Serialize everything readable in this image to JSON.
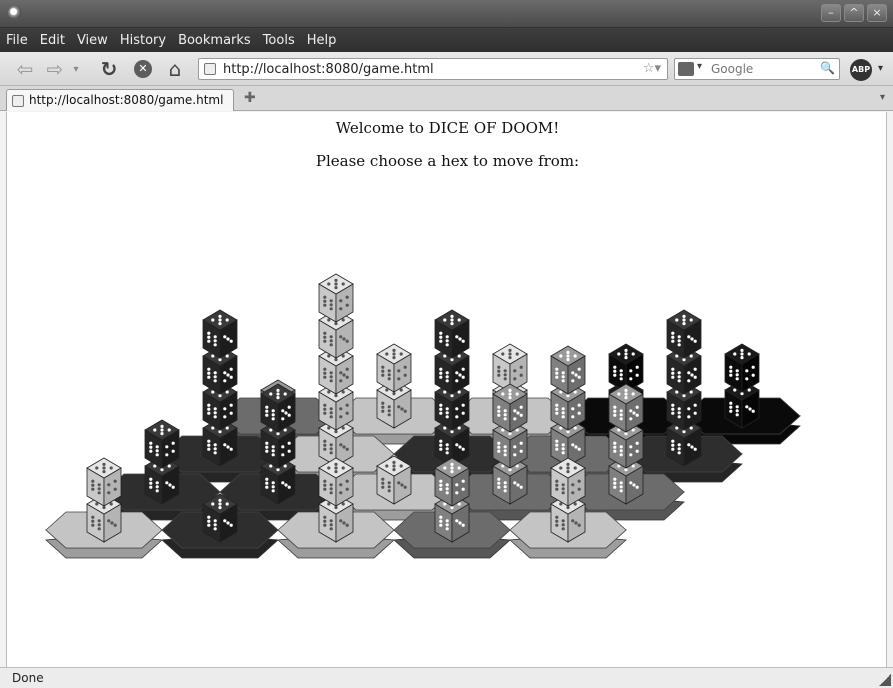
{
  "window": {
    "min_glyph": "–",
    "max_glyph": "^",
    "close_glyph": "×"
  },
  "menu": [
    "File",
    "Edit",
    "View",
    "History",
    "Bookmarks",
    "Tools",
    "Help"
  ],
  "toolbar": {
    "back_glyph": "⇦",
    "forward_glyph": "⇨",
    "history_dropdown_glyph": "▾",
    "reload_glyph": "↻",
    "stop_glyph": "✕",
    "home_glyph": "⌂",
    "url": "http://localhost:8080/game.html",
    "bookmark_star": "☆▾",
    "search_placeholder": "Google",
    "search_engine_dropdown": "▾",
    "search_glyph": "🔍",
    "adblock_label": "ABP",
    "adblock_dropdown": "▾"
  },
  "tabs": [
    {
      "label": "http://localhost:8080/game.html",
      "active": true
    }
  ],
  "tab_controls": {
    "new_tab_glyph": "✚",
    "list_all_glyph": "▾"
  },
  "page": {
    "welcome": "Welcome to DICE OF DOOM!",
    "prompt": "Please choose a hex to move from:"
  },
  "status": {
    "text": "Done"
  },
  "colors": {
    "player_fills": [
      "#c4c4c4",
      "#2e2e2e",
      "#6c6c6c",
      "#0a0a0a"
    ],
    "die_faces": [
      {
        "top": "#e6e6e6",
        "left": "#c8c8c8",
        "right": "#b4b4b4",
        "pip": "#555555"
      },
      {
        "top": "#3a3a3a",
        "left": "#262626",
        "right": "#1c1c1c",
        "pip": "#ffffff"
      },
      {
        "top": "#9a9a9a",
        "left": "#808080",
        "right": "#6e6e6e",
        "pip": "#ffffff"
      },
      {
        "top": "#1a1a1a",
        "left": "#0c0c0c",
        "right": "#050505",
        "pip": "#ffffff"
      }
    ]
  },
  "board": {
    "rows": 4,
    "cols": 5,
    "cells": [
      {
        "player": 2,
        "dice": 1
      },
      {
        "player": 0,
        "dice": 2
      },
      {
        "player": 0,
        "dice": 2
      },
      {
        "player": 3,
        "dice": 2
      },
      {
        "player": 3,
        "dice": 2
      },
      {
        "player": 1,
        "dice": 4
      },
      {
        "player": 0,
        "dice": 5
      },
      {
        "player": 1,
        "dice": 4
      },
      {
        "player": 2,
        "dice": 3
      },
      {
        "player": 1,
        "dice": 4
      },
      {
        "player": 1,
        "dice": 2
      },
      {
        "player": 1,
        "dice": 3
      },
      {
        "player": 0,
        "dice": 1
      },
      {
        "player": 2,
        "dice": 3
      },
      {
        "player": 2,
        "dice": 3
      },
      {
        "player": 0,
        "dice": 2
      },
      {
        "player": 1,
        "dice": 1
      },
      {
        "player": 0,
        "dice": 2
      },
      {
        "player": 2,
        "dice": 2
      },
      {
        "player": 0,
        "dice": 2
      }
    ]
  }
}
